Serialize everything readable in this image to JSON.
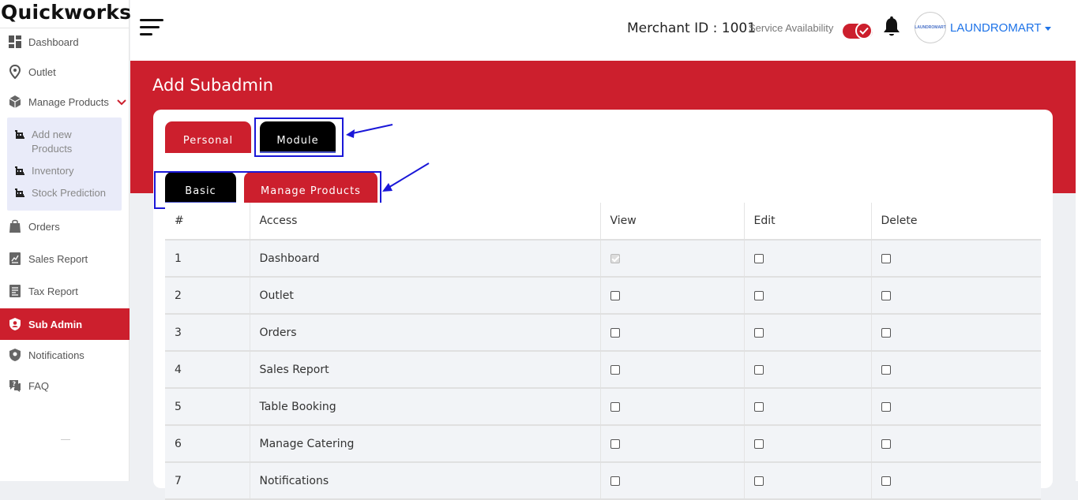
{
  "brand": {
    "logo_text": "Quickworks"
  },
  "sidebar": {
    "items": [
      {
        "label": "Dashboard",
        "icon": "dashboard-icon"
      },
      {
        "label": "Outlet",
        "icon": "location-pin-icon"
      },
      {
        "label": "Manage Products",
        "icon": "box-icon",
        "expanded": true
      },
      {
        "label": "Orders",
        "icon": "shopping-bag-icon"
      },
      {
        "label": "Sales Report",
        "icon": "report-icon"
      },
      {
        "label": "Tax Report",
        "icon": "receipt-icon"
      },
      {
        "label": "Sub Admin",
        "icon": "shield-user-icon",
        "active": true
      },
      {
        "label": "Notifications",
        "icon": "shield-bell-icon"
      },
      {
        "label": "FAQ",
        "icon": "faq-icon"
      }
    ],
    "submenu": [
      {
        "label": "Add new Products",
        "icon": "cart-icon"
      },
      {
        "label": "Inventory",
        "icon": "cart-icon"
      },
      {
        "label": "Stock Prediction",
        "icon": "cart-icon"
      }
    ]
  },
  "header": {
    "merchant_id": "Merchant ID : 1001",
    "service_label": "Service Availability",
    "service_on": true,
    "user_name": "LAUNDROMART",
    "avatar_text": "LAUNDROMART"
  },
  "page": {
    "title": "Add Subadmin",
    "main_tabs": [
      {
        "label": "Personal",
        "active": false
      },
      {
        "label": "Module",
        "active": true
      }
    ],
    "sub_tabs": [
      {
        "label": "Basic",
        "active": true
      },
      {
        "label": "Manage Products",
        "active": false
      }
    ]
  },
  "table": {
    "headers": [
      "#",
      "Access",
      "View",
      "Edit",
      "Delete"
    ],
    "rows": [
      {
        "num": "1",
        "access": "Dashboard",
        "view": true,
        "view_disabled": true,
        "edit": false,
        "delete": false
      },
      {
        "num": "2",
        "access": "Outlet",
        "view": false,
        "edit": false,
        "delete": false
      },
      {
        "num": "3",
        "access": "Orders",
        "view": false,
        "edit": false,
        "delete": false
      },
      {
        "num": "4",
        "access": "Sales Report",
        "view": false,
        "edit": false,
        "delete": false
      },
      {
        "num": "5",
        "access": "Table Booking",
        "view": false,
        "edit": false,
        "delete": false
      },
      {
        "num": "6",
        "access": "Manage Catering",
        "view": false,
        "edit": false,
        "delete": false
      },
      {
        "num": "7",
        "access": "Notifications",
        "view": false,
        "edit": false,
        "delete": false
      }
    ]
  },
  "colors": {
    "accent_red": "#cc1f2d",
    "highlight_blue": "#1a17d8",
    "link_blue": "#1e73e8"
  }
}
